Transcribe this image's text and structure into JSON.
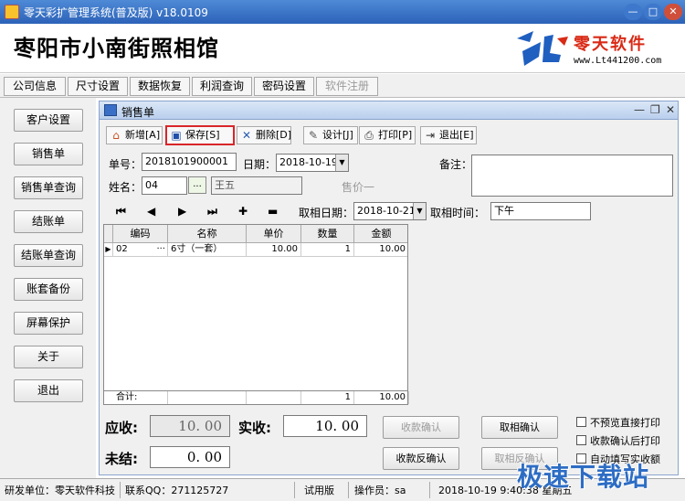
{
  "window": {
    "title": "零天彩扩管理系统(普及版)  v18.0109"
  },
  "header": {
    "company": "枣阳市小南街照相馆",
    "logo_brand": "零天软件",
    "logo_url": "www.Lt441200.com"
  },
  "tabs": [
    {
      "label": "公司信息"
    },
    {
      "label": "尺寸设置"
    },
    {
      "label": "数据恢复"
    },
    {
      "label": "利润查询"
    },
    {
      "label": "密码设置"
    },
    {
      "label": "软件注册"
    }
  ],
  "sidebar": [
    {
      "label": "客户设置"
    },
    {
      "label": "销售单"
    },
    {
      "label": "销售单查询"
    },
    {
      "label": "结账单"
    },
    {
      "label": "结账单查询"
    },
    {
      "label": "账套备份"
    },
    {
      "label": "屏幕保护"
    },
    {
      "label": "关于"
    },
    {
      "label": "退出"
    }
  ],
  "child": {
    "title": "销售单",
    "toolbar": {
      "add": "新增[A]",
      "save": "保存[S]",
      "delete": "删除[D]",
      "design": "设计[J]",
      "print": "打印[P]",
      "exit": "退出[E]"
    },
    "form": {
      "order_no_label": "单号：",
      "order_no": "2018101900001",
      "date_label": "日期：",
      "date": "2018-10-19",
      "remark_label": "备注：",
      "name_label": "姓名：",
      "name_code": "04",
      "name_browse": "...",
      "name_value": "王五",
      "sales_label": "售价一",
      "pick_date_label": "取相日期：",
      "pick_date": "2018-10-21",
      "pick_time_label": "取相时间：",
      "pick_time": "下午"
    },
    "nav": {
      "first": "⏮",
      "prev": "◀",
      "next": "▶",
      "last": "⏭",
      "add": "✚",
      "remove": "▬"
    },
    "table": {
      "headers": [
        "编码",
        "名称",
        "单价",
        "数量",
        "金额"
      ],
      "rows": [
        {
          "code": "02",
          "ellipsis": "···",
          "name": "6寸（一套）",
          "price": "10.00",
          "qty": "1",
          "amount": "10.00"
        }
      ],
      "total": {
        "label": "合计:",
        "qty": "1",
        "amount": "10.00"
      }
    },
    "summary": {
      "receivable_label": "应收:",
      "receivable": "10. 00",
      "received_label": "实收:",
      "received": "10. 00",
      "unsettled_label": "未结:",
      "unsettled": "0. 00",
      "confirm_pay": "收款确认",
      "confirm_pickup": "取相确认",
      "reverse_pay": "收款反确认",
      "reverse_pickup": "取相反确认",
      "opt1": "不预览直接打印",
      "opt2": "收款确认后打印",
      "opt3": "自动填写实收额"
    }
  },
  "status": {
    "developer": "研发单位：零天软件科技",
    "qq": "联系QQ：271125727",
    "edition": "试用版",
    "operator": "操作员：sa",
    "datetime": "2018-10-19 9:40:38 星期五"
  },
  "watermark": "极速下载站"
}
